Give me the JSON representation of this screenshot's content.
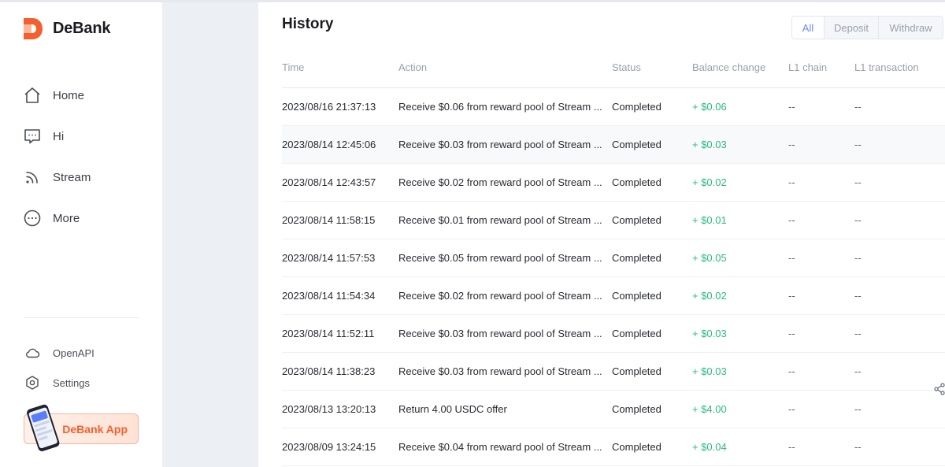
{
  "app": {
    "name": "DeBank"
  },
  "colors": {
    "accent": "#f45f2f",
    "positive": "#2abb7f",
    "active_tab": "#6a89f8"
  },
  "sidebar": {
    "items": [
      {
        "label": "Home",
        "icon": "home-icon"
      },
      {
        "label": "Hi",
        "icon": "chat-icon"
      },
      {
        "label": "Stream",
        "icon": "stream-icon"
      },
      {
        "label": "More",
        "icon": "more-icon"
      }
    ],
    "sub_items": [
      {
        "label": "OpenAPI",
        "icon": "cloud-icon"
      },
      {
        "label": "Settings",
        "icon": "gear-icon"
      }
    ],
    "app_banner": "DeBank App"
  },
  "main": {
    "title": "History",
    "filters": [
      {
        "label": "All",
        "active": true
      },
      {
        "label": "Deposit",
        "active": false
      },
      {
        "label": "Withdraw",
        "active": false
      }
    ],
    "table": {
      "columns": [
        "Time",
        "Action",
        "Status",
        "Balance change",
        "L1 chain",
        "L1 transaction"
      ],
      "rows": [
        [
          "2023/08/16 21:37:13",
          "Receive $0.06 from reward pool of Stream ...",
          "Completed",
          "+ $0.06",
          "--",
          "--"
        ],
        [
          "2023/08/14 12:45:06",
          "Receive $0.03 from reward pool of Stream ...",
          "Completed",
          "+ $0.03",
          "--",
          "--"
        ],
        [
          "2023/08/14 12:43:57",
          "Receive $0.02 from reward pool of Stream ...",
          "Completed",
          "+ $0.02",
          "--",
          "--"
        ],
        [
          "2023/08/14 11:58:15",
          "Receive $0.01 from reward pool of Stream ...",
          "Completed",
          "+ $0.01",
          "--",
          "--"
        ],
        [
          "2023/08/14 11:57:53",
          "Receive $0.05 from reward pool of Stream ...",
          "Completed",
          "+ $0.05",
          "--",
          "--"
        ],
        [
          "2023/08/14 11:54:34",
          "Receive $0.02 from reward pool of Stream ...",
          "Completed",
          "+ $0.02",
          "--",
          "--"
        ],
        [
          "2023/08/14 11:52:11",
          "Receive $0.03 from reward pool of Stream ...",
          "Completed",
          "+ $0.03",
          "--",
          "--"
        ],
        [
          "2023/08/14 11:38:23",
          "Receive $0.03 from reward pool of Stream ...",
          "Completed",
          "+ $0.03",
          "--",
          "--"
        ],
        [
          "2023/08/13 13:20:13",
          "Return 4.00 USDC offer",
          "Completed",
          "+ $4.00",
          "--",
          "--"
        ],
        [
          "2023/08/09 13:24:15",
          "Receive $0.04 from reward pool of Stream ...",
          "Completed",
          "+ $0.04",
          "--",
          "--"
        ]
      ]
    }
  }
}
